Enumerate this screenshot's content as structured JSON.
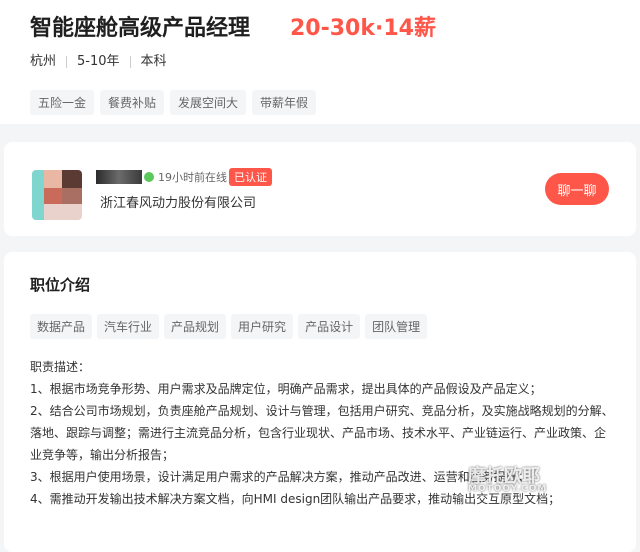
{
  "job": {
    "title": "智能座舱高级产品经理",
    "salary": "20-30k·14薪",
    "location": "杭州",
    "experience": "5-10年",
    "education": "本科",
    "benefits": [
      "五险一金",
      "餐费补贴",
      "发展空间大",
      "带薪年假"
    ]
  },
  "company": {
    "online_status": "19小时前在线",
    "verified_badge": "已认证",
    "name": "浙江春风动力股份有限公司",
    "chat_label": "聊一聊"
  },
  "description": {
    "section_title": "职位介绍",
    "skills": [
      "数据产品",
      "汽车行业",
      "产品规划",
      "用户研究",
      "产品设计",
      "团队管理"
    ],
    "lines": [
      "职责描述：",
      "1、根据市场竞争形势、用户需求及品牌定位，明确产品需求，提出具体的产品假设及产品定义；",
      "2、结合公司市场规划，负责座舱产品规划、设计与管理，包括用户研究、竞品分析，及实施战略规划的分解、落地、跟踪与调整；需进行主流竞品分析，包含行业现状、产品市场、技术水平、产业链运行、产业政策、企业竞争等，输出分析报告；",
      "3、根据用户使用场景，设计满足用户需求的产品解决方案，推动产品改进、运营和服务提升；",
      "4、需推动开发输出技术解决方案文档，向HMI design团队输出产品要求，推动输出交互原型文档；"
    ]
  },
  "watermark": {
    "text": "摩托欧耶",
    "sub": "MOTOOY.COM"
  }
}
